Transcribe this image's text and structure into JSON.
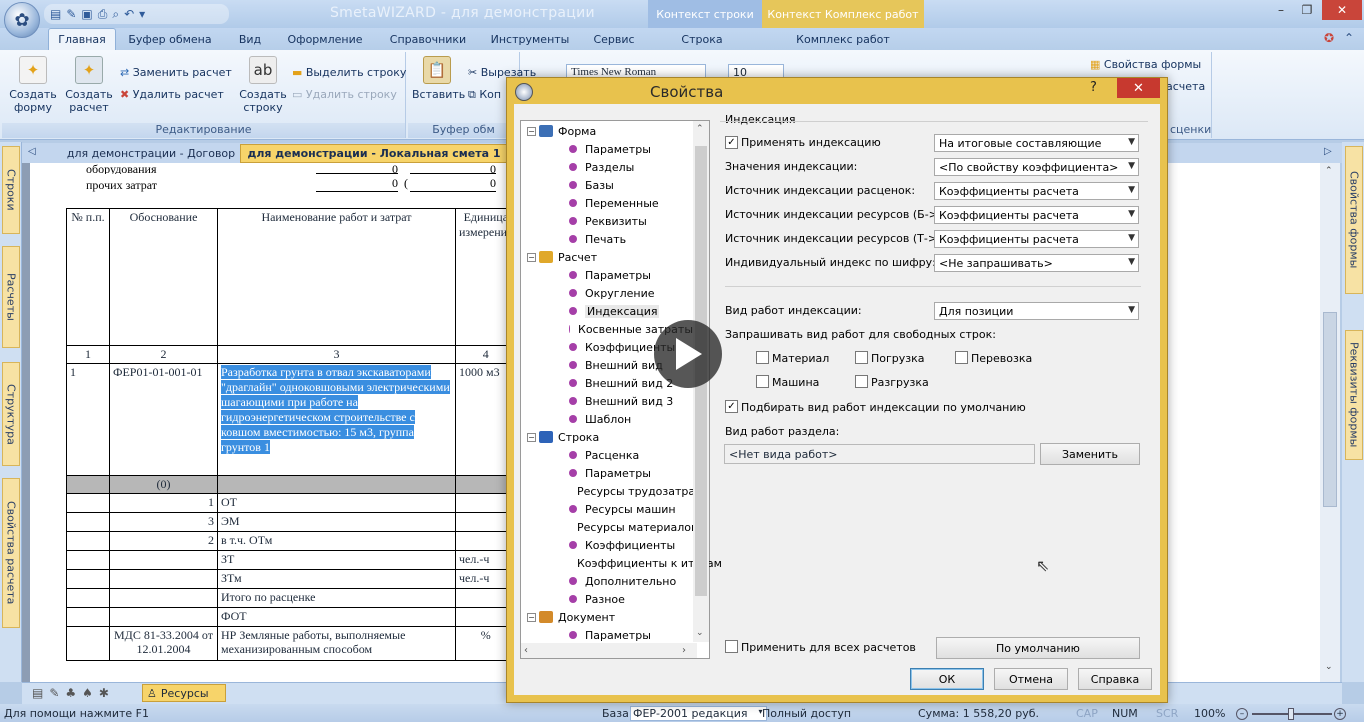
{
  "app": {
    "title": "SmetaWIZARD - для демонстрации"
  },
  "context_tabs": [
    "Контекст строки",
    "Контекст Комплекс работ"
  ],
  "ribbon_tabs": [
    "Главная",
    "Буфер обмена",
    "Вид",
    "Оформление",
    "Справочники",
    "Инструменты",
    "Сервис",
    "Строка",
    "Комплекс работ"
  ],
  "ribbon": {
    "create_form": "Создать форму",
    "create_calc": "Создать расчет",
    "replace_calc": "Заменить расчет",
    "delete_calc": "Удалить расчет",
    "create_row": "Создать строку",
    "select_row": "Выделить строку",
    "delete_row": "Удалить строку",
    "group_edit": "Редактирование",
    "paste": "Вставить",
    "cut": "Вырезать",
    "copy": "Коп",
    "group_clipboard": "Буфер обм",
    "font_name": "Times New Roman",
    "font_size": "10",
    "form_props": "Свойства формы",
    "calc_short": "асчета",
    "group_right": "сценки"
  },
  "left_tabs": [
    "Строки",
    "Расчеты",
    "Структура",
    "Свойства расчета"
  ],
  "right_tabs": [
    "Свойства формы",
    "Реквизиты формы"
  ],
  "doc_tabs": [
    "для демонстрации - Договор",
    "для демонстрации - Локальная смета 1"
  ],
  "document": {
    "above": [
      "оборудования",
      "прочих затрат"
    ],
    "zeros": [
      "0",
      "0",
      "0",
      "0"
    ],
    "paren": [
      "(",
      "("
    ],
    "headers": [
      "№ п.п.",
      "Обоснование",
      "Наименование работ и затрат",
      "Единица измерения"
    ],
    "col_numbers": [
      "1",
      "2",
      "3",
      "4"
    ],
    "row1": {
      "num": "1",
      "code": "ФЕР01-01-001-01",
      "name": "Разработка грунта в отвал экскаваторами \"драглайн\" одноковшовыми электрическими шагающими при работе на гидроэнергетическом строительстве с ковшом вместимостью: 15 м3, группа грунтов 1",
      "unit": "1000 м3",
      "sub": "(0)"
    },
    "details": [
      {
        "n": "1",
        "label": "ОТ",
        "unit": ""
      },
      {
        "n": "3",
        "label": "ЭМ",
        "unit": ""
      },
      {
        "n": "2",
        "label": "в т.ч. ОТм",
        "unit": ""
      },
      {
        "n": "",
        "label": "ЗТ",
        "unit": "чел.-ч"
      },
      {
        "n": "",
        "label": "ЗТм",
        "unit": "чел.-ч"
      },
      {
        "n": "",
        "label": "Итого по расценке",
        "unit": ""
      },
      {
        "n": "",
        "label": "ФОТ",
        "unit": ""
      }
    ],
    "mds_code": "МДС 81-33.2004 от 12.01.2004",
    "mds_name": "НР Земляные работы, выполняемые механизированным способом",
    "mds_unit": "%"
  },
  "bottom": {
    "resources": "Ресурсы"
  },
  "status": {
    "help": "Для помощи нажмите F1",
    "base_label": "База:",
    "base_value": "ФЕР-2001 редакция",
    "access": "Полный доступ",
    "sum": "Сумма: 1 558,20 руб.",
    "cap": "CAP",
    "num": "NUM",
    "scr": "SCR",
    "zoom": "100%"
  },
  "dialog": {
    "title": "Свойства",
    "help": "?",
    "close": "✕",
    "tree": [
      {
        "label": "Форма",
        "level": 0,
        "icon": "folder"
      },
      {
        "label": "Параметры",
        "level": 1
      },
      {
        "label": "Разделы",
        "level": 1
      },
      {
        "label": "Базы",
        "level": 1
      },
      {
        "label": "Переменные",
        "level": 1
      },
      {
        "label": "Реквизиты",
        "level": 1
      },
      {
        "label": "Печать",
        "level": 1
      },
      {
        "label": "Расчет",
        "level": 0,
        "icon": "calc"
      },
      {
        "label": "Параметры",
        "level": 1
      },
      {
        "label": "Округление",
        "level": 1
      },
      {
        "label": "Индексация",
        "level": 1,
        "selected": true
      },
      {
        "label": "Косвенные затраты",
        "level": 1
      },
      {
        "label": "Коэффициенты",
        "level": 1
      },
      {
        "label": "Внешний вид",
        "level": 1
      },
      {
        "label": "Внешний вид 2",
        "level": 1
      },
      {
        "label": "Внешний вид 3",
        "level": 1
      },
      {
        "label": "Шаблон",
        "level": 1
      },
      {
        "label": "Строка",
        "level": 0,
        "icon": "row"
      },
      {
        "label": "Расценка",
        "level": 1
      },
      {
        "label": "Параметры",
        "level": 1
      },
      {
        "label": "Ресурсы трудозатрат",
        "level": 1
      },
      {
        "label": "Ресурсы машин",
        "level": 1
      },
      {
        "label": "Ресурсы материалов",
        "level": 1
      },
      {
        "label": "Коэффициенты",
        "level": 1
      },
      {
        "label": "Коэффициенты к итогам",
        "level": 1
      },
      {
        "label": "Дополнительно",
        "level": 1
      },
      {
        "label": "Разное",
        "level": 1
      },
      {
        "label": "Документ",
        "level": 0,
        "icon": "doc"
      },
      {
        "label": "Параметры",
        "level": 1
      }
    ],
    "group_title": "Индексация",
    "apply_indexing": "Применять индексацию",
    "apply_indexing_checked": true,
    "fields": [
      {
        "label": "Применять индексацию",
        "value": "На итоговые составляющие"
      },
      {
        "label": "Значения индексации:",
        "value": "<По свойству коэффициента>"
      },
      {
        "label": "Источник индексации расценок:",
        "value": "Коэффициенты расчета"
      },
      {
        "label": "Источник индексации ресурсов (Б->Т):",
        "value": "Коэффициенты расчета"
      },
      {
        "label": "Источник индексации ресурсов (Т->Б):",
        "value": "Коэффициенты расчета"
      },
      {
        "label": "Индивидуальный индекс по шифру:",
        "value": "<Не запрашивать>"
      }
    ],
    "work_type_label": "Вид работ индексации:",
    "work_type_value": "Для позиции",
    "ask_label": "Запрашивать вид работ для свободных строк:",
    "checks": [
      {
        "label": "Материал",
        "checked": false
      },
      {
        "label": "Погрузка",
        "checked": false
      },
      {
        "label": "Перевозка",
        "checked": false
      },
      {
        "label": "Машина",
        "checked": false
      },
      {
        "label": "Разгрузка",
        "checked": false
      }
    ],
    "default_select": "Подбирать вид работ индексации по умолчанию",
    "default_select_checked": true,
    "section_label": "Вид работ раздела:",
    "section_value": "<Нет вида работ>",
    "replace_btn": "Заменить",
    "apply_all": "Применить для всех расчетов",
    "default_btn": "По умолчанию",
    "ok": "ОК",
    "cancel": "Отмена",
    "help_btn": "Справка"
  },
  "colors": {
    "selection": "#3a8ee0",
    "dialog_frame": "#e8c24d",
    "close_red": "#c7392f"
  }
}
